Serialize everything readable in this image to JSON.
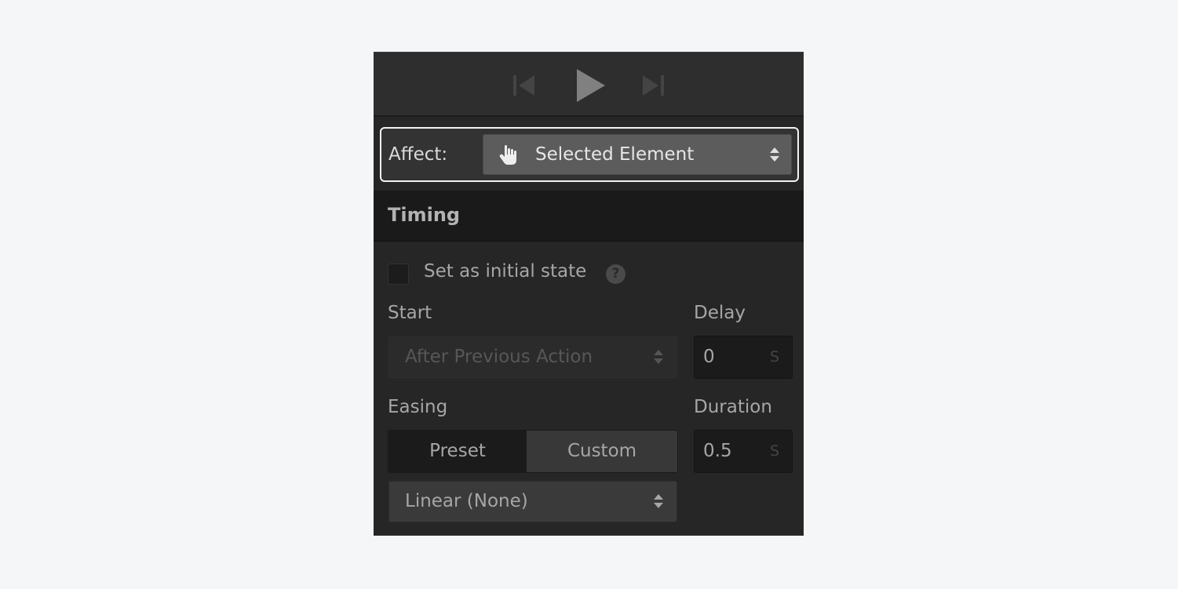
{
  "transport": {
    "prev_icon": "skip-back-icon",
    "play_icon": "play-icon",
    "next_icon": "skip-forward-icon"
  },
  "affect": {
    "label": "Affect:",
    "icon": "hand-pointer-icon",
    "value": "Selected Element"
  },
  "timing": {
    "title": "Timing",
    "initial_state_label": "Set as initial state",
    "initial_state_checked": false,
    "help_glyph": "?",
    "start_label": "Start",
    "start_value": "After Previous Action",
    "delay_label": "Delay",
    "delay_value": "0",
    "delay_unit": "S",
    "easing_label": "Easing",
    "easing_modes": [
      "Preset",
      "Custom"
    ],
    "easing_mode_selected": "Preset",
    "easing_value": "Linear (None)",
    "duration_label": "Duration",
    "duration_value": "0.5",
    "duration_unit": "S"
  },
  "colors": {
    "panel_bg": "#262626",
    "header_bg": "#1a1a1a",
    "focus_outline": "#f2f2f2",
    "page_bg": "#f5f6f8"
  }
}
